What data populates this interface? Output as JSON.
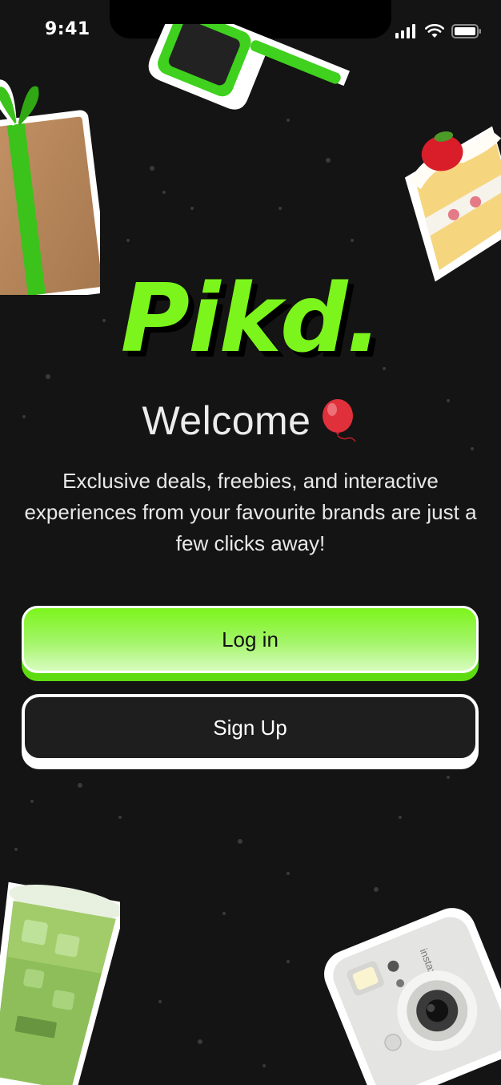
{
  "status_bar": {
    "time": "9:41"
  },
  "logo": "Pikd.",
  "welcome": {
    "text": "Welcome",
    "emoji": "🎈"
  },
  "subtitle": "Exclusive deals, freebies, and interactive experiences from your favourite brands are just a few clicks away!",
  "buttons": {
    "login": "Log in",
    "signup": "Sign Up"
  },
  "colors": {
    "accent": "#7CF51C",
    "background": "#141414"
  },
  "stickers": [
    "sunglasses",
    "gift-box",
    "cake-slice",
    "matcha-drink",
    "instax-camera"
  ],
  "camera_brand": "instax"
}
